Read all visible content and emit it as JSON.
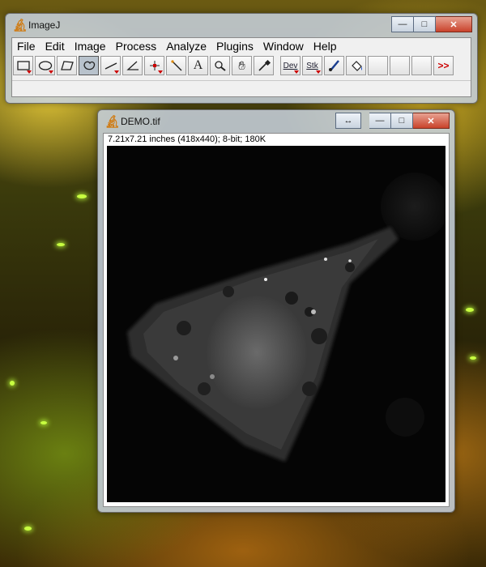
{
  "main_window": {
    "title": "ImageJ",
    "menu": [
      "File",
      "Edit",
      "Image",
      "Process",
      "Analyze",
      "Plugins",
      "Window",
      "Help"
    ],
    "tools": [
      {
        "icon": "rectangle-select-icon"
      },
      {
        "icon": "oval-select-icon"
      },
      {
        "icon": "polygon-select-icon"
      },
      {
        "icon": "freehand-select-icon"
      },
      {
        "icon": "line-tool-icon"
      },
      {
        "icon": "angle-tool-icon"
      },
      {
        "icon": "point-tool-icon"
      },
      {
        "icon": "wand-tool-icon"
      },
      {
        "icon": "text-tool-icon",
        "label": "A"
      },
      {
        "icon": "magnifier-icon"
      },
      {
        "icon": "hand-tool-icon"
      },
      {
        "icon": "dropper-icon"
      },
      {
        "icon": "developer-menu-icon",
        "label": "Dev"
      },
      {
        "icon": "stack-menu-icon",
        "label": "Stk"
      },
      {
        "icon": "brush-icon"
      },
      {
        "icon": "flood-fill-icon"
      },
      {
        "icon": "more-tools-icon",
        "label": ">>"
      }
    ],
    "status": ""
  },
  "image_window": {
    "title": "DEMO.tif",
    "info": "7.21x7.21 inches (418x440); 8-bit; 180K"
  },
  "colors": {
    "close_button": "#c9432b",
    "window_frame": "#c8d2e1",
    "tool_triangle": "#cc0000"
  }
}
